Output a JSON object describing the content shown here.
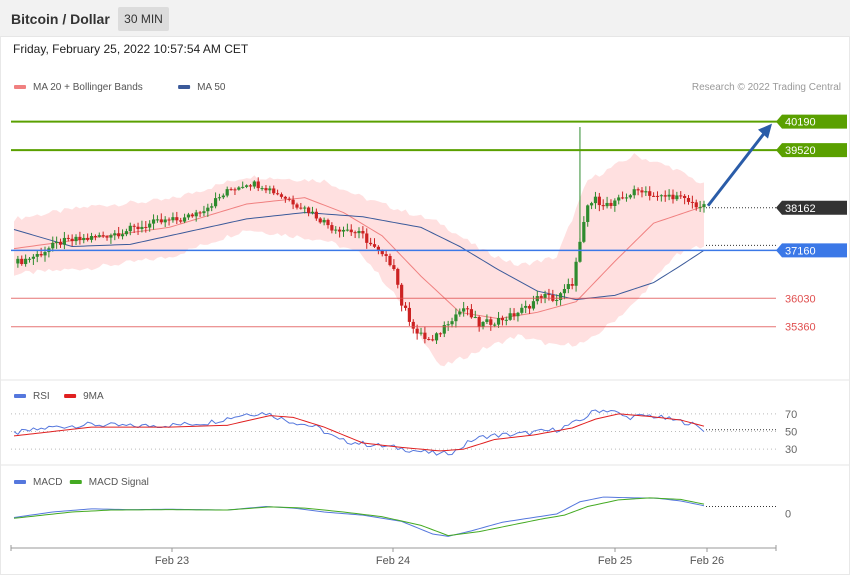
{
  "header": {
    "title": "Bitcoin / Dollar",
    "timeframe": "30 MIN",
    "timestamp": "Friday, February 25, 2022 10:57:54 AM CET"
  },
  "copyright": "Research © 2022 Trading Central",
  "colors": {
    "candle_up": "#2e8b2e",
    "candle_down": "#cc2222",
    "bollinger_fill": "#ffd6d6",
    "ma20": "#f08080",
    "ma50": "#3b5a9a",
    "resistance": "#5aa000",
    "pivot": "#3b78e7",
    "support": "#e05050",
    "last_price": "#333333",
    "rsi": "#5577dd",
    "rsi_ma": "#e02020",
    "macd": "#5577dd",
    "macd_signal": "#44aa22",
    "arrow": "#2a5ca8"
  },
  "chart_data": [
    {
      "type": "candlestick",
      "panel": "price",
      "legend": [
        {
          "name": "MA 20 + Bollinger Bands",
          "color": "#f08080"
        },
        {
          "name": "MA 50",
          "color": "#3b5a9a"
        }
      ],
      "x_ticks": [
        "Feb 23",
        "Feb 24",
        "Feb 25",
        "Feb 26"
      ],
      "ylim": [
        34200,
        40700
      ],
      "levels": [
        {
          "value": 40190,
          "label": "40190",
          "kind": "resistance"
        },
        {
          "value": 39520,
          "label": "39520",
          "kind": "resistance"
        },
        {
          "value": 38162,
          "label": "38162",
          "kind": "last"
        },
        {
          "value": 37160,
          "label": "37160",
          "kind": "pivot"
        },
        {
          "value": 36030,
          "label": "36030",
          "kind": "support"
        },
        {
          "value": 35360,
          "label": "35360",
          "kind": "support"
        }
      ],
      "arrow_target": 40190,
      "close_anchors": [
        [
          0,
          36850
        ],
        [
          6,
          37050
        ],
        [
          12,
          37350
        ],
        [
          20,
          37450
        ],
        [
          28,
          37600
        ],
        [
          36,
          37800
        ],
        [
          44,
          37900
        ],
        [
          50,
          38200
        ],
        [
          56,
          38600
        ],
        [
          60,
          38750
        ],
        [
          64,
          38700
        ],
        [
          70,
          38400
        ],
        [
          76,
          38100
        ],
        [
          82,
          37700
        ],
        [
          86,
          37650
        ],
        [
          90,
          37500
        ],
        [
          94,
          37100
        ],
        [
          98,
          36800
        ],
        [
          100,
          35900
        ],
        [
          104,
          35200
        ],
        [
          108,
          35000
        ],
        [
          112,
          35500
        ],
        [
          116,
          35800
        ],
        [
          120,
          35400
        ],
        [
          124,
          35500
        ],
        [
          128,
          35600
        ],
        [
          132,
          35800
        ],
        [
          136,
          36100
        ],
        [
          140,
          36000
        ],
        [
          144,
          36400
        ],
        [
          146,
          37300
        ],
        [
          148,
          38200
        ],
        [
          150,
          38350
        ],
        [
          154,
          38200
        ],
        [
          158,
          38450
        ],
        [
          162,
          38600
        ],
        [
          166,
          38400
        ],
        [
          170,
          38450
        ],
        [
          174,
          38300
        ],
        [
          178,
          38162
        ]
      ],
      "bollinger_upper_anchors": [
        [
          0,
          37900
        ],
        [
          20,
          38200
        ],
        [
          40,
          38350
        ],
        [
          60,
          38900
        ],
        [
          80,
          38800
        ],
        [
          90,
          38400
        ],
        [
          100,
          38100
        ],
        [
          110,
          37800
        ],
        [
          120,
          37200
        ],
        [
          130,
          36800
        ],
        [
          140,
          37000
        ],
        [
          148,
          38800
        ],
        [
          160,
          39400
        ],
        [
          170,
          39100
        ],
        [
          178,
          38700
        ]
      ],
      "bollinger_lower_anchors": [
        [
          0,
          36600
        ],
        [
          20,
          36750
        ],
        [
          40,
          37000
        ],
        [
          60,
          37650
        ],
        [
          80,
          37400
        ],
        [
          90,
          37050
        ],
        [
          100,
          35900
        ],
        [
          110,
          34400
        ],
        [
          120,
          34800
        ],
        [
          130,
          35150
        ],
        [
          140,
          34900
        ],
        [
          148,
          35000
        ],
        [
          160,
          35900
        ],
        [
          170,
          37000
        ],
        [
          178,
          37300
        ]
      ],
      "ma20_anchors": [
        [
          0,
          37200
        ],
        [
          20,
          37450
        ],
        [
          40,
          37700
        ],
        [
          60,
          38250
        ],
        [
          75,
          38400
        ],
        [
          85,
          38050
        ],
        [
          95,
          37500
        ],
        [
          105,
          36550
        ],
        [
          115,
          35700
        ],
        [
          125,
          35550
        ],
        [
          135,
          35700
        ],
        [
          145,
          35950
        ],
        [
          155,
          36900
        ],
        [
          165,
          37800
        ],
        [
          178,
          38200
        ]
      ],
      "ma50_anchors": [
        [
          0,
          37650
        ],
        [
          15,
          37250
        ],
        [
          30,
          37300
        ],
        [
          45,
          37600
        ],
        [
          60,
          37900
        ],
        [
          75,
          38050
        ],
        [
          90,
          37950
        ],
        [
          105,
          37700
        ],
        [
          115,
          37250
        ],
        [
          125,
          36700
        ],
        [
          135,
          36200
        ],
        [
          145,
          36000
        ],
        [
          155,
          36100
        ],
        [
          165,
          36400
        ],
        [
          172,
          36800
        ],
        [
          178,
          37160
        ]
      ]
    },
    {
      "type": "line",
      "panel": "rsi",
      "legend": [
        {
          "name": "RSI",
          "color": "#5577dd"
        },
        {
          "name": "9MA",
          "color": "#e02020"
        }
      ],
      "levels": [
        {
          "value": 70,
          "label": "70"
        },
        {
          "value": 50,
          "label": "50"
        },
        {
          "value": 30,
          "label": "30"
        }
      ],
      "ylim": [
        20,
        80
      ],
      "series": [
        {
          "name": "RSI",
          "points": [
            [
              0,
              48
            ],
            [
              10,
              55
            ],
            [
              20,
              58
            ],
            [
              30,
              56
            ],
            [
              40,
              57
            ],
            [
              50,
              60
            ],
            [
              60,
              70
            ],
            [
              65,
              71
            ],
            [
              70,
              63
            ],
            [
              78,
              55
            ],
            [
              84,
              40
            ],
            [
              92,
              35
            ],
            [
              98,
              32
            ],
            [
              104,
              28
            ],
            [
              110,
              24
            ],
            [
              114,
              28
            ],
            [
              118,
              40
            ],
            [
              122,
              45
            ],
            [
              130,
              47
            ],
            [
              140,
              52
            ],
            [
              146,
              62
            ],
            [
              150,
              74
            ],
            [
              154,
              74
            ],
            [
              158,
              66
            ],
            [
              164,
              68
            ],
            [
              170,
              63
            ],
            [
              174,
              60
            ],
            [
              178,
              52
            ]
          ]
        },
        {
          "name": "9MA",
          "points": [
            [
              0,
              45
            ],
            [
              20,
              55
            ],
            [
              40,
              55
            ],
            [
              55,
              57
            ],
            [
              66,
              68
            ],
            [
              72,
              66
            ],
            [
              80,
              55
            ],
            [
              90,
              37
            ],
            [
              100,
              32
            ],
            [
              110,
              28
            ],
            [
              116,
              30
            ],
            [
              124,
              41
            ],
            [
              134,
              46
            ],
            [
              144,
              54
            ],
            [
              150,
              64
            ],
            [
              156,
              70
            ],
            [
              164,
              67
            ],
            [
              172,
              63
            ],
            [
              178,
              56
            ]
          ]
        }
      ]
    },
    {
      "type": "line",
      "panel": "macd",
      "legend": [
        {
          "name": "MACD",
          "color": "#5577dd"
        },
        {
          "name": "MACD Signal",
          "color": "#44aa22"
        }
      ],
      "levels": [
        {
          "value": 0,
          "label": "0"
        }
      ],
      "ylim": [
        -400,
        300
      ],
      "series": [
        {
          "name": "MACD",
          "points": [
            [
              0,
              -50
            ],
            [
              10,
              20
            ],
            [
              20,
              60
            ],
            [
              30,
              50
            ],
            [
              40,
              55
            ],
            [
              55,
              45
            ],
            [
              65,
              90
            ],
            [
              72,
              70
            ],
            [
              80,
              20
            ],
            [
              90,
              -20
            ],
            [
              100,
              -100
            ],
            [
              108,
              -260
            ],
            [
              112,
              -290
            ],
            [
              118,
              -220
            ],
            [
              126,
              -110
            ],
            [
              134,
              -50
            ],
            [
              140,
              -5
            ],
            [
              146,
              150
            ],
            [
              152,
              210
            ],
            [
              160,
              200
            ],
            [
              166,
              195
            ],
            [
              172,
              160
            ],
            [
              178,
              100
            ]
          ]
        },
        {
          "name": "MACD Signal",
          "points": [
            [
              0,
              -60
            ],
            [
              15,
              20
            ],
            [
              25,
              45
            ],
            [
              40,
              50
            ],
            [
              55,
              45
            ],
            [
              66,
              85
            ],
            [
              75,
              70
            ],
            [
              85,
              20
            ],
            [
              95,
              -40
            ],
            [
              105,
              -150
            ],
            [
              112,
              -280
            ],
            [
              120,
              -230
            ],
            [
              128,
              -150
            ],
            [
              136,
              -70
            ],
            [
              142,
              -20
            ],
            [
              148,
              90
            ],
            [
              156,
              175
            ],
            [
              164,
              200
            ],
            [
              172,
              180
            ],
            [
              178,
              120
            ]
          ]
        }
      ]
    }
  ]
}
